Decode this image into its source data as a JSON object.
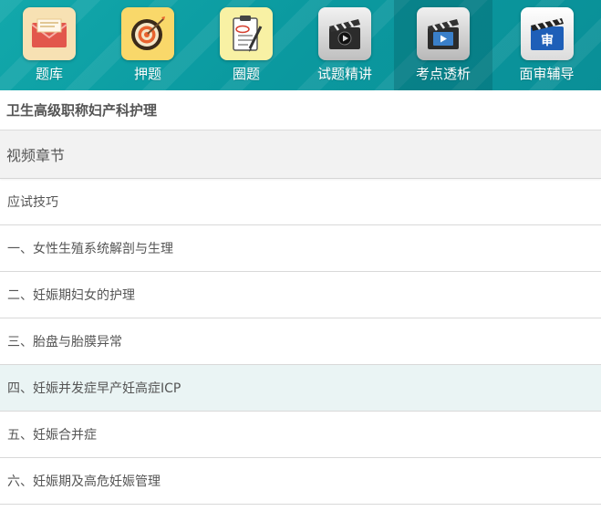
{
  "nav": {
    "items": [
      {
        "label": "题库",
        "icon": "envelope-icon"
      },
      {
        "label": "押题",
        "icon": "target-icon"
      },
      {
        "label": "圈题",
        "icon": "clipboard-icon"
      },
      {
        "label": "试题精讲",
        "icon": "film-reel-icon"
      },
      {
        "label": "考点透析",
        "icon": "video-clapper-icon"
      },
      {
        "label": "面审辅导",
        "icon": "clapperboard-shen-icon",
        "glyph": "审"
      }
    ],
    "active_index": 4,
    "colors": {
      "bar": "#0b9aa0",
      "label": "#ffffff"
    }
  },
  "course": {
    "title": "卫生高级职称妇产科护理"
  },
  "section": {
    "title": "视频章节"
  },
  "chapters": [
    {
      "label": "应试技巧"
    },
    {
      "label": "一、女性生殖系统解剖与生理"
    },
    {
      "label": "二、妊娠期妇女的护理"
    },
    {
      "label": "三、胎盘与胎膜异常"
    },
    {
      "label": "四、妊娠并发症早产妊高症ICP",
      "highlighted": true
    },
    {
      "label": "五、妊娠合并症"
    },
    {
      "label": "六、妊娠期及高危妊娠管理"
    }
  ]
}
